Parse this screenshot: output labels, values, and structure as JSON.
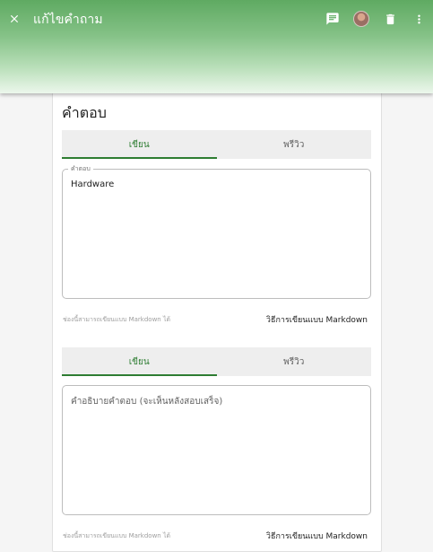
{
  "appbar": {
    "title": "แก้ไขคำถาม",
    "close_icon": "close-icon",
    "actions": [
      "comment-icon",
      "avatar",
      "delete-icon",
      "more-vert-icon"
    ]
  },
  "answer_section": {
    "title": "คำตอบ",
    "tabs": {
      "write": "เขียน",
      "preview": "พรีวิว"
    },
    "field_label": "คำตอบ",
    "field_value": "Hardware",
    "helper": "ช่องนี้สามารถเขียนแบบ Markdown ได้",
    "markdown_link": "วิธีการเขียนแบบ Markdown"
  },
  "explanation_section": {
    "tabs": {
      "write": "เขียน",
      "preview": "พรีวิว"
    },
    "placeholder": "คำอธิบายคำตอบ (จะเห็นหลังสอบเสร็จ)",
    "field_value": "",
    "helper": "ช่องนี้สามารถเขียนแบบ Markdown ได้",
    "markdown_link": "วิธีการเขียนแบบ Markdown"
  },
  "colors": {
    "appbar_top": "#5faa62",
    "accent": "#2e7d32",
    "tab_bg": "#eeeeee"
  }
}
